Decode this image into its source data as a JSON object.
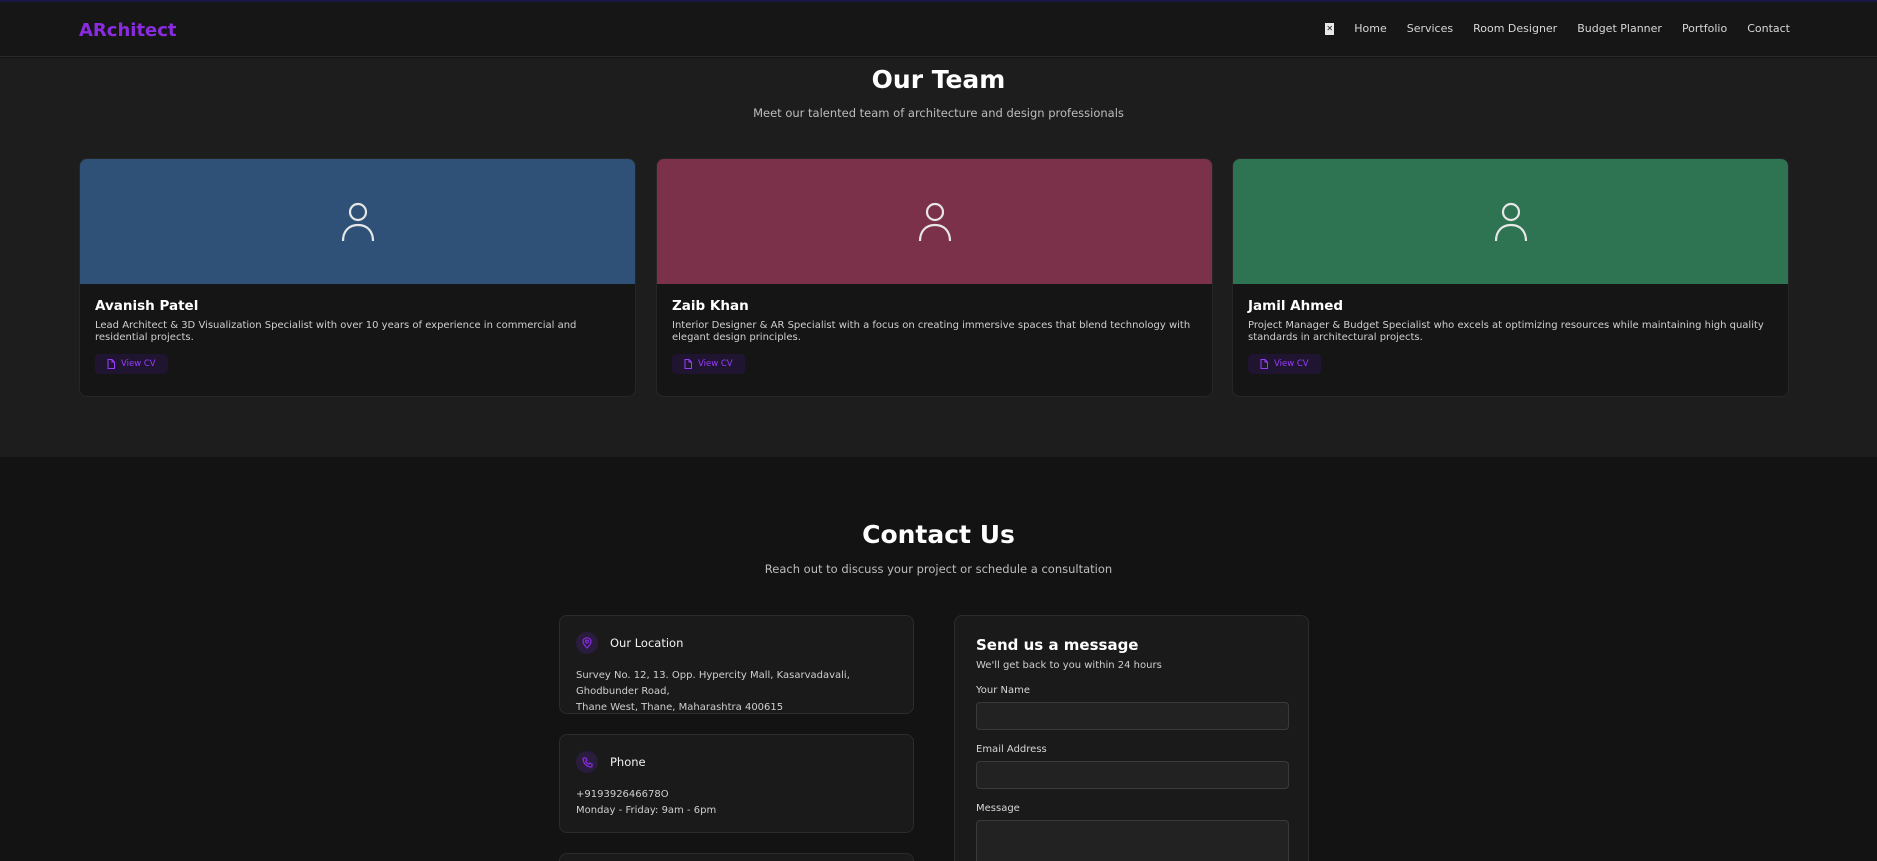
{
  "nav": {
    "brand": "ARchitect",
    "theme_toggle_icon": "x-box-icon",
    "links": [
      "Home",
      "Services",
      "Room Designer",
      "Budget Planner",
      "Portfolio",
      "Contact"
    ]
  },
  "team": {
    "title": "Our Team",
    "subtitle": "Meet our talented team of architecture and design professionals",
    "members": [
      {
        "name": "Avanish Patel",
        "desc": "Lead Architect & 3D Visualization Specialist with over 10 years of experience in commercial and residential projects.",
        "cv_label": "View CV",
        "color": "#2f5178"
      },
      {
        "name": "Zaib Khan",
        "desc": "Interior Designer & AR Specialist with a focus on creating immersive spaces that blend technology with elegant design principles.",
        "cv_label": "View CV",
        "color": "#7a3149"
      },
      {
        "name": "Jamil Ahmed",
        "desc": "Project Manager & Budget Specialist who excels at optimizing resources while maintaining high quality standards in architectural projects.",
        "cv_label": "View CV",
        "color": "#2e7452"
      }
    ]
  },
  "contact": {
    "title": "Contact Us",
    "subtitle": "Reach out to discuss your project or schedule a consultation",
    "location": {
      "title": "Our Location",
      "line1": "Survey No. 12, 13. Opp. Hypercity Mall, Kasarvadavali, Ghodbunder Road,",
      "line2": "Thane West, Thane, Maharashtra 400615"
    },
    "phone": {
      "title": "Phone",
      "line1": "+919392646678O",
      "line2": "Monday - Friday: 9am - 6pm"
    },
    "form": {
      "title": "Send us a message",
      "subtitle": "We'll get back to you within 24 hours",
      "name_label": "Your Name",
      "email_label": "Email Address",
      "message_label": "Message"
    }
  },
  "colors": {
    "accent": "#8a2be2"
  }
}
